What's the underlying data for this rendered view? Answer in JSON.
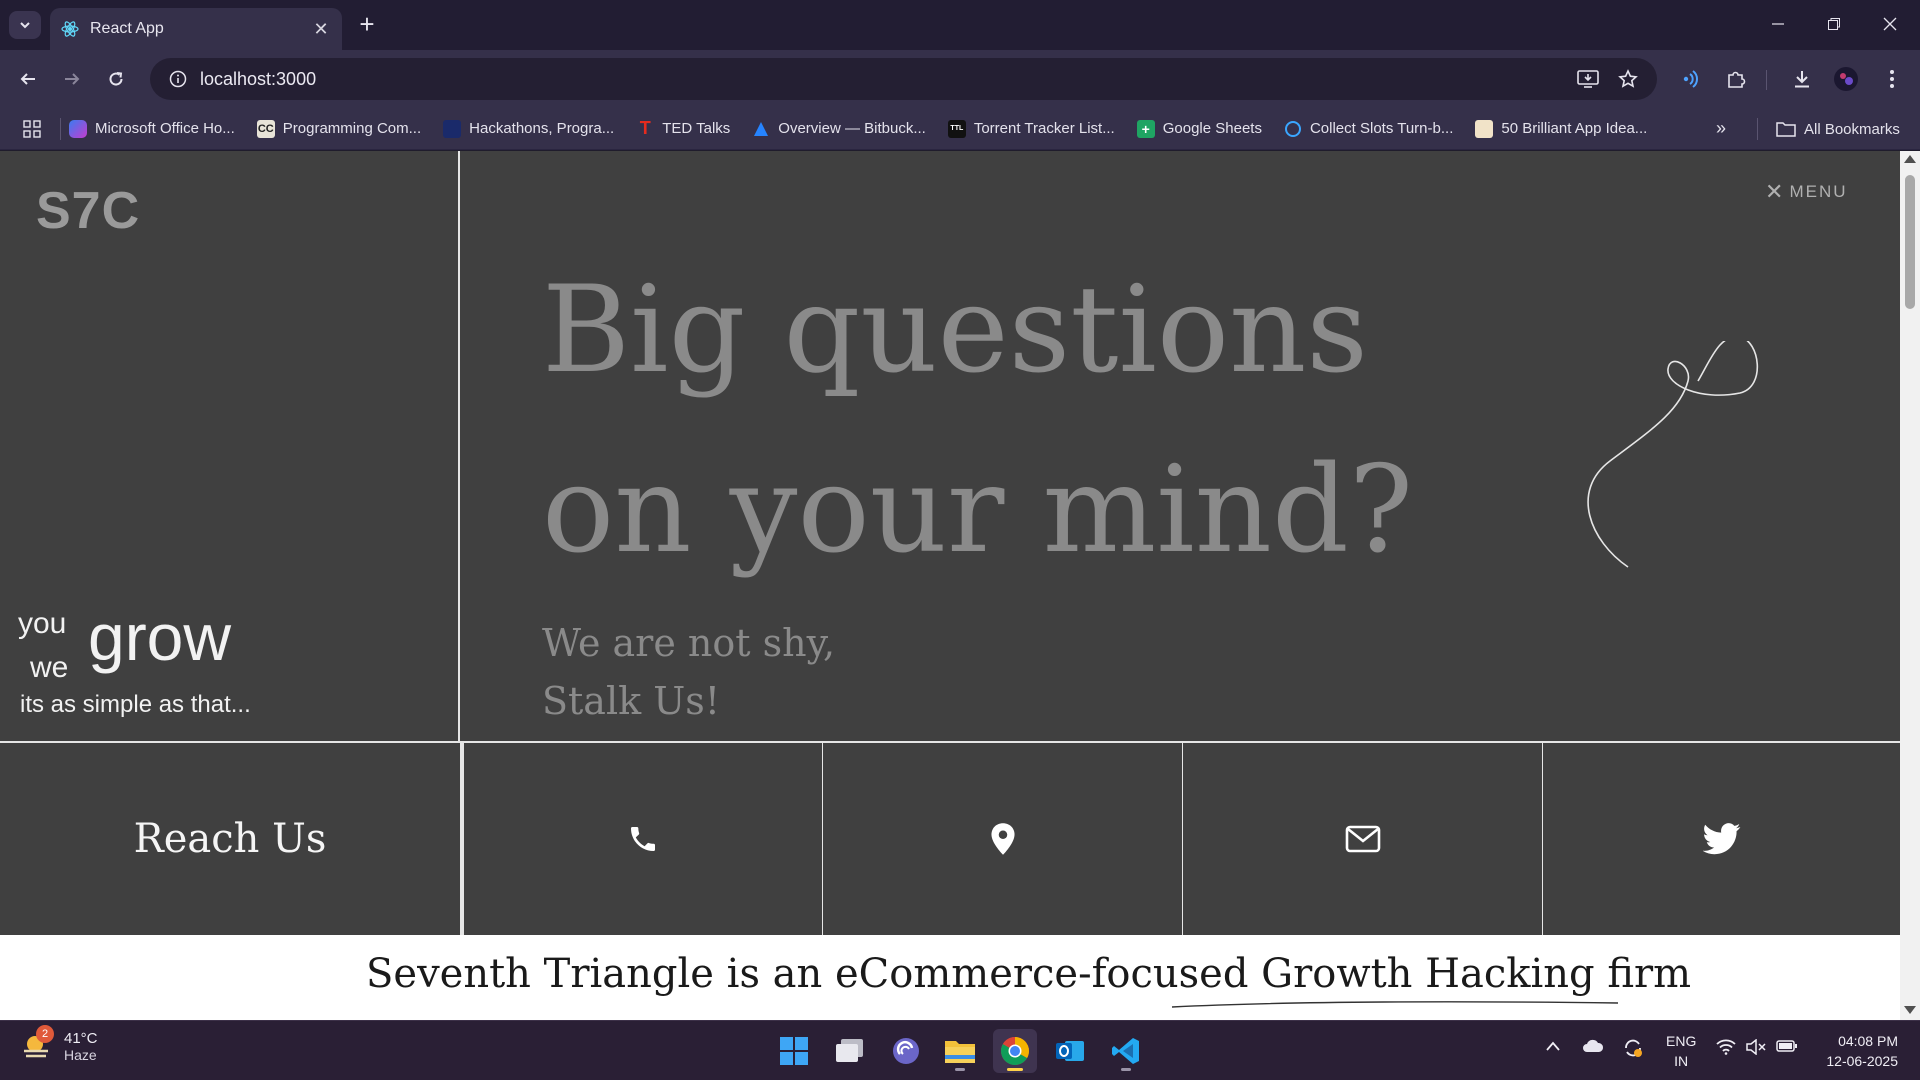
{
  "browser": {
    "tab": {
      "title": "React App",
      "favicon": "react-icon"
    },
    "address": {
      "url": "localhost:3000"
    },
    "bookmarks": [
      {
        "label": "Microsoft Office Ho...",
        "icon": "office-icon"
      },
      {
        "label": "Programming Com...",
        "icon": "cc-icon"
      },
      {
        "label": "Hackathons, Progra...",
        "icon": "devpost-icon"
      },
      {
        "label": "TED Talks",
        "icon": "ted-icon"
      },
      {
        "label": "Overview — Bitbuck...",
        "icon": "bitbucket-icon"
      },
      {
        "label": "Torrent Tracker List...",
        "icon": "ttl-icon"
      },
      {
        "label": "Google Sheets",
        "icon": "sheets-icon"
      },
      {
        "label": "Collect Slots Turn-b...",
        "icon": "slots-icon"
      },
      {
        "label": "50 Brilliant App Idea...",
        "icon": "app-ideas-icon"
      }
    ],
    "all_bookmarks": "All Bookmarks"
  },
  "page": {
    "logo": "S7C",
    "menu_label": "MENU",
    "tagline": {
      "you": "you",
      "we": "we",
      "grow": "grow",
      "sub": "its as simple as that..."
    },
    "hero": {
      "line1": "Big questions",
      "line2": "on your mind?",
      "sub1": "We are not shy,",
      "sub2": "Stalk Us!"
    },
    "reach_us": "Reach Us",
    "contact_icons": [
      "phone-icon",
      "location-pin-icon",
      "mail-icon",
      "twitter-icon"
    ],
    "about_text": "Seventh Triangle is an eCommerce-focused Growth Hacking firm"
  },
  "taskbar": {
    "weather": {
      "temp": "41°C",
      "desc": "Haze",
      "badge": "2"
    },
    "lang": {
      "line1": "ENG",
      "line2": "IN"
    },
    "clock": {
      "time": "04:08 PM",
      "date": "12-06-2025"
    }
  },
  "colors": {
    "page_bg": "#404040",
    "hero_text": "#8a8a8a",
    "chrome_bg": "#35304a"
  }
}
